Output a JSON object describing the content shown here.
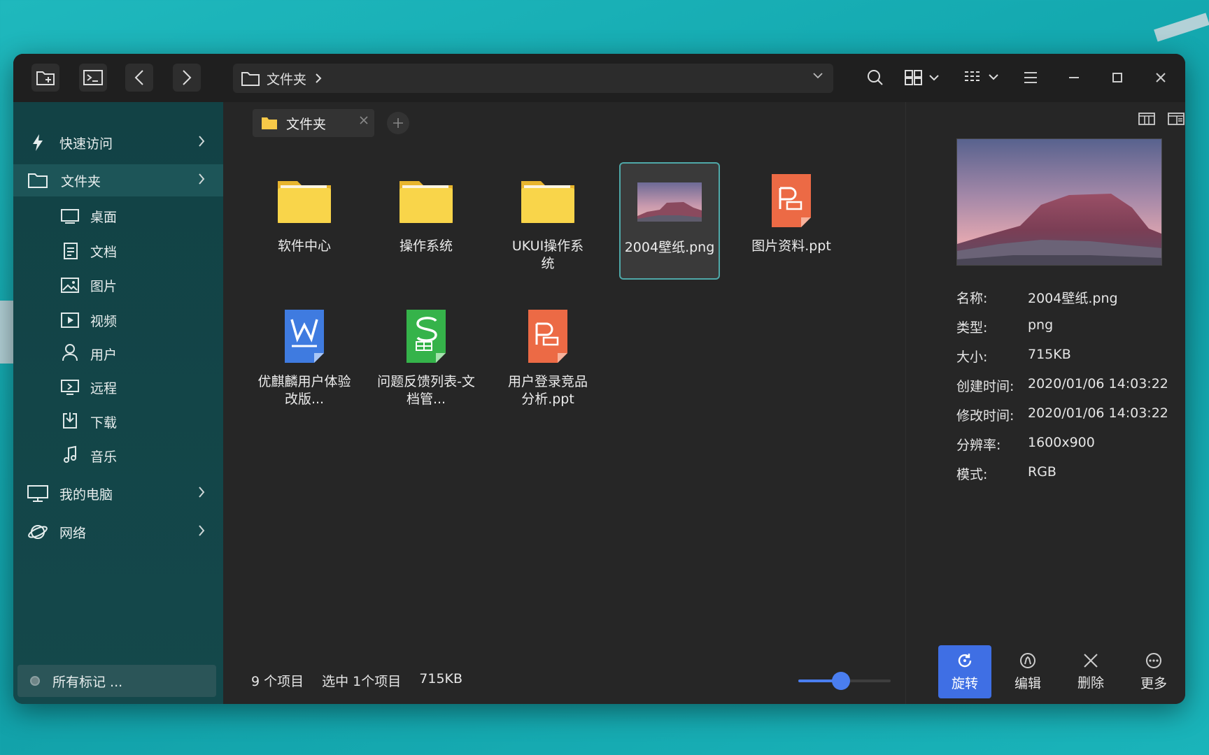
{
  "toolbar": {
    "new_folder_icon": "folder-plus-icon",
    "terminal_icon": "terminal-icon",
    "back_icon": "chevron-left-icon",
    "forward_icon": "chevron-right-icon",
    "address": "文件夹",
    "search_icon": "search-icon",
    "view_icon": "grid-view-icon",
    "sort_icon": "sort-icon",
    "menu_icon": "menu-icon"
  },
  "sidebar": {
    "items": [
      {
        "label": "快速访问",
        "icon": "lightning-icon"
      },
      {
        "label": "文件夹",
        "icon": "folder-icon"
      },
      {
        "label": "桌面",
        "icon": "desktop-icon"
      },
      {
        "label": "文档",
        "icon": "document-icon"
      },
      {
        "label": "图片",
        "icon": "image-icon"
      },
      {
        "label": "视频",
        "icon": "video-icon"
      },
      {
        "label": "用户",
        "icon": "user-icon"
      },
      {
        "label": "远程",
        "icon": "remote-icon"
      },
      {
        "label": "下载",
        "icon": "download-icon"
      },
      {
        "label": "音乐",
        "icon": "music-icon"
      },
      {
        "label": "我的电脑",
        "icon": "computer-icon"
      },
      {
        "label": "网络",
        "icon": "network-icon"
      }
    ],
    "tags_label": "所有标记 ..."
  },
  "tab": {
    "label": "文件夹"
  },
  "files": [
    {
      "name": "软件中心",
      "type": "folder"
    },
    {
      "name": "操作系统",
      "type": "folder"
    },
    {
      "name": "UKUI操作系统",
      "type": "folder"
    },
    {
      "name": "2004壁纸.png",
      "type": "image"
    },
    {
      "name": "图片资料.ppt",
      "type": "ppt"
    },
    {
      "name": "优麒麟用户体验改版...",
      "type": "doc"
    },
    {
      "name": "问题反馈列表-文档管...",
      "type": "sheet"
    },
    {
      "name": "用户登录竞品分析.ppt",
      "type": "ppt"
    }
  ],
  "status": {
    "count": "9 个项目",
    "selected": "选中 1个项目",
    "size": "715KB"
  },
  "zoom_fraction": 0.45,
  "details": [
    {
      "k": "名称:",
      "v": "2004壁纸.png"
    },
    {
      "k": "类型:",
      "v": "png"
    },
    {
      "k": "大小:",
      "v": "715KB"
    },
    {
      "k": "创建时间:",
      "v": "2020/01/06 14:03:22"
    },
    {
      "k": "修改时间:",
      "v": "2020/01/06 14:03:22"
    },
    {
      "k": "分辨率:",
      "v": "1600x900"
    },
    {
      "k": "模式:",
      "v": "RGB"
    }
  ],
  "actions": [
    {
      "label": "旋转",
      "icon": "rotate-icon"
    },
    {
      "label": "编辑",
      "icon": "edit-icon"
    },
    {
      "label": "删除",
      "icon": "close-icon"
    },
    {
      "label": "更多",
      "icon": "more-icon"
    }
  ],
  "colors": {
    "accent": "#3f6fe4",
    "sidebar": "#14464a",
    "folder": "#f7c948",
    "ppt": "#ec6a45",
    "doc": "#3f7be0",
    "sheet": "#35b34a"
  }
}
